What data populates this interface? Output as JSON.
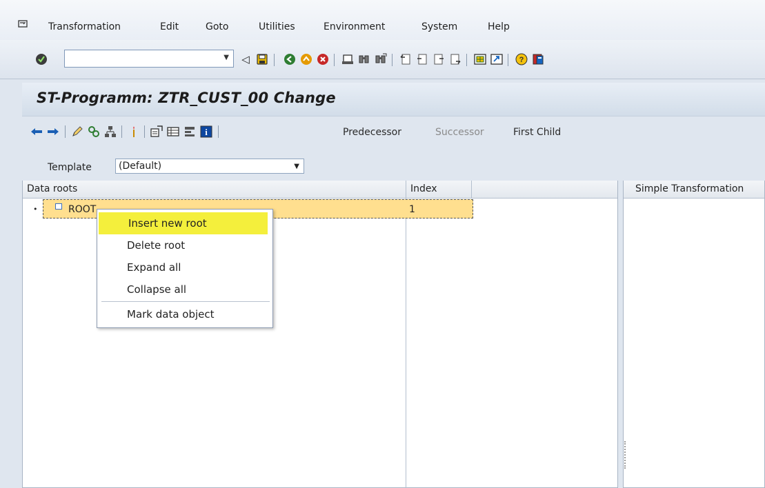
{
  "menubar": {
    "system_icon": "window-menu-icon",
    "items": [
      {
        "label": "Transformation",
        "accel": "T"
      },
      {
        "label": "Edit",
        "accel": "E"
      },
      {
        "label": "Goto",
        "accel": "G"
      },
      {
        "label": "Utilities",
        "accel": "U"
      },
      {
        "label": "Environment",
        "accel": "v"
      },
      {
        "label": "System",
        "accel": "y"
      },
      {
        "label": "Help",
        "accel": "H"
      }
    ]
  },
  "toolbar": {
    "command_field": {
      "value": "",
      "placeholder": ""
    },
    "icons": [
      "enter-check-icon",
      "back-arrow-icon",
      "save-icon",
      "back-icon",
      "exit-icon",
      "cancel-icon",
      "print-icon",
      "find-icon",
      "find-next-icon",
      "first-page-icon",
      "previous-page-icon",
      "next-page-icon",
      "last-page-icon",
      "create-session-icon",
      "shortcut-icon",
      "help-icon",
      "customize-layout-icon"
    ]
  },
  "page": {
    "title": "ST-Programm: ZTR_CUST_00 Change"
  },
  "app_toolbar": {
    "predecessor": "Predecessor",
    "successor": "Successor",
    "first_child": "First Child"
  },
  "template": {
    "label": "Template",
    "value": "(Default)"
  },
  "tree": {
    "columns": [
      "Data roots",
      "Index"
    ],
    "rows": [
      {
        "name": "ROOT",
        "index": "1"
      }
    ]
  },
  "right_panel": {
    "header": "Simple Transformation"
  },
  "context_menu": {
    "items": [
      {
        "label": "Insert new root",
        "highlighted": true
      },
      {
        "label": "Delete root"
      },
      {
        "label": "Expand all"
      },
      {
        "label": "Collapse all"
      },
      {
        "label": "Mark data object"
      }
    ]
  },
  "colors": {
    "selected_row": "#ffdf8f",
    "menu_highlight": "#f4ef3c",
    "background": "#dfe6ef"
  }
}
